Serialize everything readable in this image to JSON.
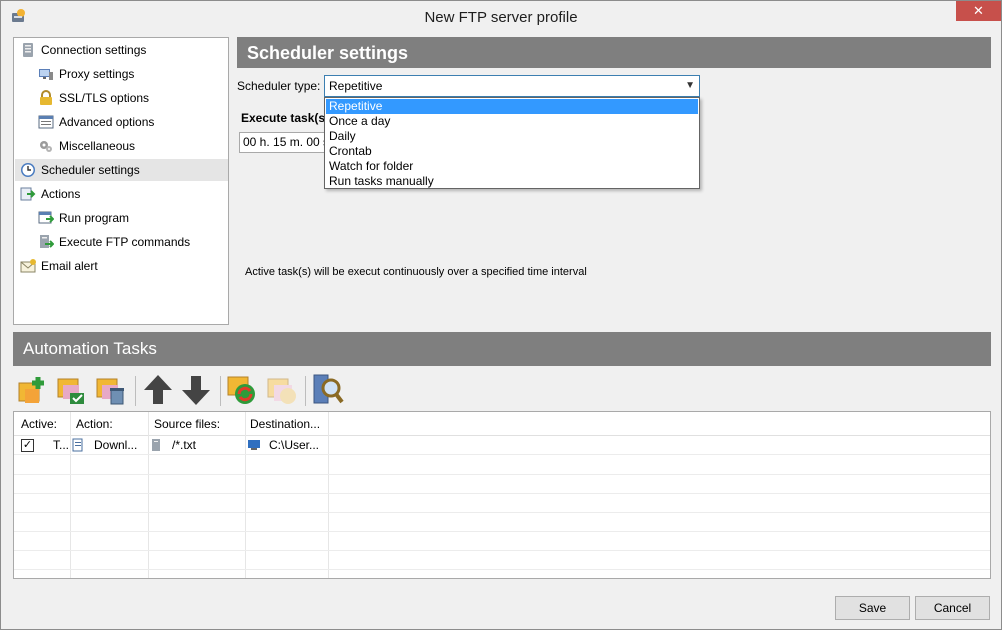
{
  "window": {
    "title": "New FTP server profile",
    "close_glyph": "✕"
  },
  "nav": {
    "items": [
      {
        "label": "Connection settings",
        "icon": "server-icon"
      },
      {
        "label": "Proxy settings",
        "icon": "monitor-icon"
      },
      {
        "label": "SSL/TLS options",
        "icon": "lock-icon"
      },
      {
        "label": "Advanced options",
        "icon": "window-list-icon"
      },
      {
        "label": "Miscellaneous",
        "icon": "gears-icon"
      },
      {
        "label": "Scheduler settings",
        "icon": "clock-icon"
      },
      {
        "label": "Actions",
        "icon": "actions-icon"
      },
      {
        "label": "Run program",
        "icon": "run-program-icon"
      },
      {
        "label": "Execute FTP commands",
        "icon": "ftp-commands-icon"
      },
      {
        "label": "Email alert",
        "icon": "email-icon"
      }
    ],
    "selected": "Scheduler settings"
  },
  "scheduler": {
    "header": "Scheduler settings",
    "type_label": "Scheduler type:",
    "type_value": "Repetitive",
    "options": [
      "Repetitive",
      "Once a day",
      "Daily",
      "Crontab",
      "Watch for folder",
      "Run tasks manually"
    ],
    "execute_label": "Execute task(s)",
    "interval_value": "00 h. 15 m. 00 s.",
    "description": "Active task(s) will be execut continuously over a specified time interval"
  },
  "automation": {
    "header": "Automation Tasks",
    "toolbar": [
      {
        "name": "add-task-button",
        "icon": "add-task-icon"
      },
      {
        "name": "edit-task-button",
        "icon": "edit-task-icon"
      },
      {
        "name": "delete-task-button",
        "icon": "delete-task-icon"
      },
      {
        "name": "move-up-button",
        "icon": "arrow-up-icon"
      },
      {
        "name": "move-down-button",
        "icon": "arrow-down-icon"
      },
      {
        "name": "run-task-button",
        "icon": "refresh-icon"
      },
      {
        "name": "stop-task-button",
        "icon": "disabled-task-icon"
      },
      {
        "name": "search-button",
        "icon": "search-icon"
      }
    ],
    "columns": [
      "Active:",
      "Action:",
      "Source files:",
      "Destination..."
    ],
    "rows": [
      {
        "active": true,
        "check": "✓",
        "type": "T...",
        "action": "Downl...",
        "source": "/*.txt",
        "destination": "C:\\User..."
      }
    ]
  },
  "buttons": {
    "save": "Save",
    "cancel": "Cancel"
  },
  "colors": {
    "header_gray": "#7f7f7f",
    "selection_blue": "#3399ff",
    "close_red": "#c7504b"
  }
}
